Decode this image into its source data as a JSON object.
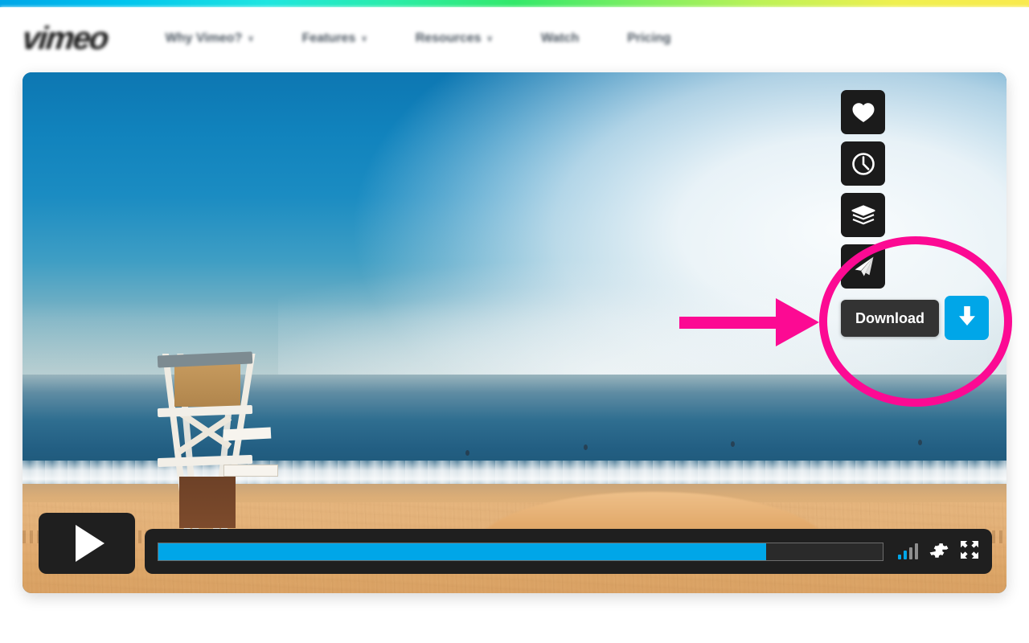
{
  "site": {
    "brand": "vimeo",
    "nav": [
      {
        "label": "Why Vimeo?",
        "caret": "∨"
      },
      {
        "label": "Features",
        "caret": "∨"
      },
      {
        "label": "Resources",
        "caret": "∨"
      },
      {
        "label": "Watch",
        "caret": ""
      },
      {
        "label": "Pricing",
        "caret": ""
      }
    ]
  },
  "player": {
    "video_title": "Beach lifeguard tower at sunrise",
    "play_label": "Play",
    "progress_percent": 84,
    "quality_bars": [
      {
        "level": 1,
        "color": "#00a6e8"
      },
      {
        "level": 2,
        "color": "#00a6e8"
      },
      {
        "level": 3,
        "color": "#8e8e8e"
      },
      {
        "level": 4,
        "color": "#8e8e8e"
      }
    ],
    "settings_label": "Settings",
    "fullscreen_label": "Fullscreen"
  },
  "rail": {
    "items": [
      {
        "icon": "heart-icon",
        "label": "Like"
      },
      {
        "icon": "clock-icon",
        "label": "Watch Later"
      },
      {
        "icon": "collections-icon",
        "label": "Add to collection"
      },
      {
        "icon": "share-icon",
        "label": "Share"
      }
    ],
    "download": {
      "tooltip": "Download",
      "icon": "download-arrow-icon",
      "color": "#00a6e8"
    }
  },
  "annotation": {
    "highlight_color": "#fc0a93",
    "shape": "ellipse",
    "arrow": "right-arrow",
    "target": "Download"
  },
  "theme": {
    "gradient_start": "#00a6e8",
    "gradient_mid_cyan": "#1fe6e0",
    "gradient_mid_green": "#33e96a",
    "gradient_end": "#f9ea4e",
    "accent_blue": "#00a6e8",
    "control_bg": "#1f1f1f",
    "tooltip_bg": "#333333"
  }
}
